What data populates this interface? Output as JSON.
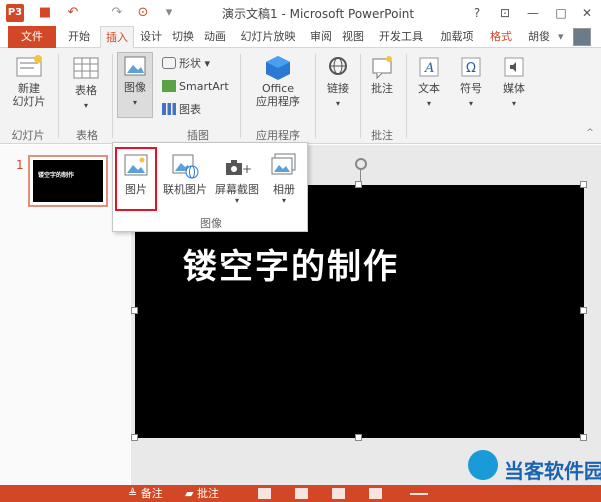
{
  "titlebar": {
    "app_icon": "P3",
    "title": "演示文稿1 - Microsoft PowerPoint",
    "qat_icons": [
      "save-icon",
      "undo-icon",
      "redo-icon",
      "from-beginning-icon",
      "customize-icon"
    ],
    "help": "?",
    "restore": "⊡",
    "minimize": "—",
    "maximize": "□",
    "close": "✕"
  },
  "tabs": [
    "文件",
    "开始",
    "插入",
    "设计",
    "切换",
    "动画",
    "幻灯片放映",
    "审阅",
    "视图",
    "开发工具",
    "加载项",
    "格式"
  ],
  "user": "胡俊",
  "ribbon": {
    "slides": {
      "button": "新建\n幻灯片",
      "label": "幻灯片"
    },
    "tables": {
      "button": "表格",
      "label": "表格"
    },
    "images": {
      "button": "图像"
    },
    "illustrations": {
      "items": [
        "形状",
        "SmartArt",
        "图表"
      ],
      "label": "插图"
    },
    "apps": {
      "button": "Office\n应用程序",
      "label": "应用程序"
    },
    "links": {
      "button": "链接"
    },
    "comments": {
      "button": "批注",
      "label": "批注"
    },
    "text": {
      "button": "文本"
    },
    "symbols": {
      "button": "符号"
    },
    "media": {
      "button": "媒体"
    }
  },
  "dropdown": {
    "items": [
      "图片",
      "联机图片",
      "屏幕截图",
      "相册"
    ],
    "selected": "图片",
    "label": "图像"
  },
  "thumbnails": [
    {
      "number": "1",
      "text": "镂空字的制作"
    }
  ],
  "slide": {
    "title": "镂空字的制作"
  },
  "statusbar": {
    "notes": "备注",
    "comments": "批注"
  },
  "watermark": "当客软件园",
  "colors": {
    "accent": "#d24726",
    "highlight": "#e81123"
  }
}
